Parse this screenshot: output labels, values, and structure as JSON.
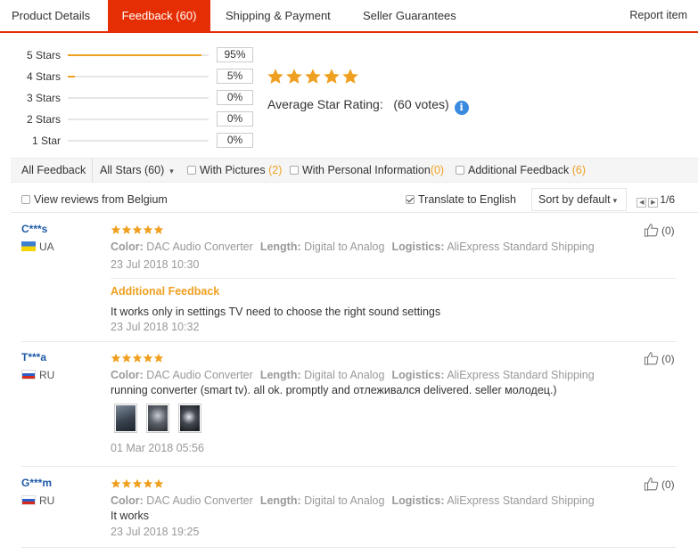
{
  "tabs": [
    {
      "label": "Product Details"
    },
    {
      "label": "Feedback (60)"
    },
    {
      "label": "Shipping & Payment"
    },
    {
      "label": "Seller Guarantees"
    }
  ],
  "report_label": "Report item",
  "rating_breakdown": [
    {
      "label": "5 Stars",
      "percent_text": "95%",
      "fraction": 0.95
    },
    {
      "label": "4 Stars",
      "percent_text": "5%",
      "fraction": 0.05
    },
    {
      "label": "3 Stars",
      "percent_text": "0%",
      "fraction": 0
    },
    {
      "label": "2 Stars",
      "percent_text": "0%",
      "fraction": 0
    },
    {
      "label": "1 Star",
      "percent_text": "0%",
      "fraction": 0
    }
  ],
  "average": {
    "label": "Average Star Rating:",
    "votes": "(60 votes)",
    "stars": 5
  },
  "filters": {
    "all_feedback": "All Feedback",
    "all_stars": "All Stars (60)",
    "with_pictures": "With Pictures",
    "with_pictures_count": "(2)",
    "with_personal": "With Personal Information",
    "with_personal_count": "(0)",
    "additional": "Additional Feedback",
    "additional_count": "(6)"
  },
  "view_row": {
    "belgium": "View reviews from Belgium",
    "translate": "Translate to English",
    "sort": "Sort by default",
    "page": "1/6"
  },
  "attr_labels": {
    "color": "Color:",
    "length": "Length:",
    "logistics": "Logistics:"
  },
  "reviews": [
    {
      "name": "C***s",
      "country": "UA",
      "stars": 5,
      "color": "DAC Audio Converter",
      "length": "Digital to Analog",
      "logistics": "AliExpress Standard Shipping",
      "date": "23 Jul 2018 10:30",
      "helpful": "(0)",
      "additional_label": "Additional Feedback",
      "additional_text": "It works only in settings TV need to choose the right sound settings",
      "additional_date": "23 Jul 2018 10:32"
    },
    {
      "name": "T***a",
      "country": "RU",
      "stars": 5,
      "color": "DAC Audio Converter",
      "length": "Digital to Analog",
      "logistics": "AliExpress Standard Shipping",
      "text": "running converter (smart tv). all ok. promptly and отлеживался delivered. seller молодец.)",
      "date": "01 Mar 2018 05:56",
      "helpful": "(0)"
    },
    {
      "name": "G***m",
      "country": "RU",
      "stars": 5,
      "color": "DAC Audio Converter",
      "length": "Digital to Analog",
      "logistics": "AliExpress Standard Shipping",
      "text": "It works",
      "date": "23 Jul 2018 19:25",
      "helpful": "(0)"
    }
  ],
  "colors": {
    "accent": "#e62e04",
    "star": "#f0a020",
    "link": "#1d5aa5",
    "info": "#3a8be0"
  }
}
